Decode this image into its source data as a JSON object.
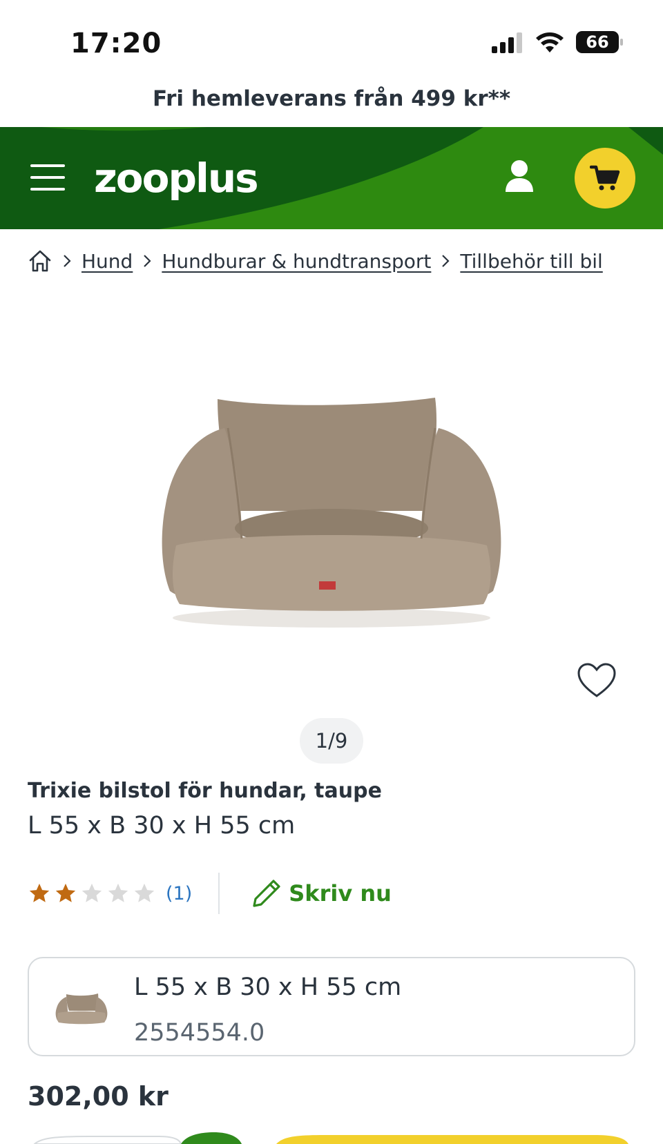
{
  "status_bar": {
    "time": "17:20",
    "battery": "66"
  },
  "promo": {
    "text": "Fri hemleverans från 499 kr**"
  },
  "header": {
    "logo": "zooplus"
  },
  "breadcrumb": {
    "items": [
      {
        "label": "Hund"
      },
      {
        "label": "Hundburar & hundtransport"
      },
      {
        "label": "Tillbehör till bil"
      }
    ]
  },
  "gallery": {
    "counter": "1/9"
  },
  "product": {
    "title": "Trixie bilstol för hundar, taupe",
    "subtitle": "L 55 x B 30 x H 55 cm",
    "rating": {
      "value": 2,
      "max": 5,
      "count_label": "(1)"
    },
    "write_review_label": "Skriv nu",
    "variant": {
      "name": "L 55 x B 30 x H 55 cm",
      "sku": "2554554.0"
    },
    "price": "302,00 kr"
  },
  "colors": {
    "header_dark": "#0f5a12",
    "header_light": "#2e8a10",
    "cart_yellow": "#f2d02c",
    "star_filled": "#c06a12",
    "star_empty": "#d9d9d9",
    "link_blue": "#2a74c0",
    "write_green": "#2f8a1c"
  }
}
